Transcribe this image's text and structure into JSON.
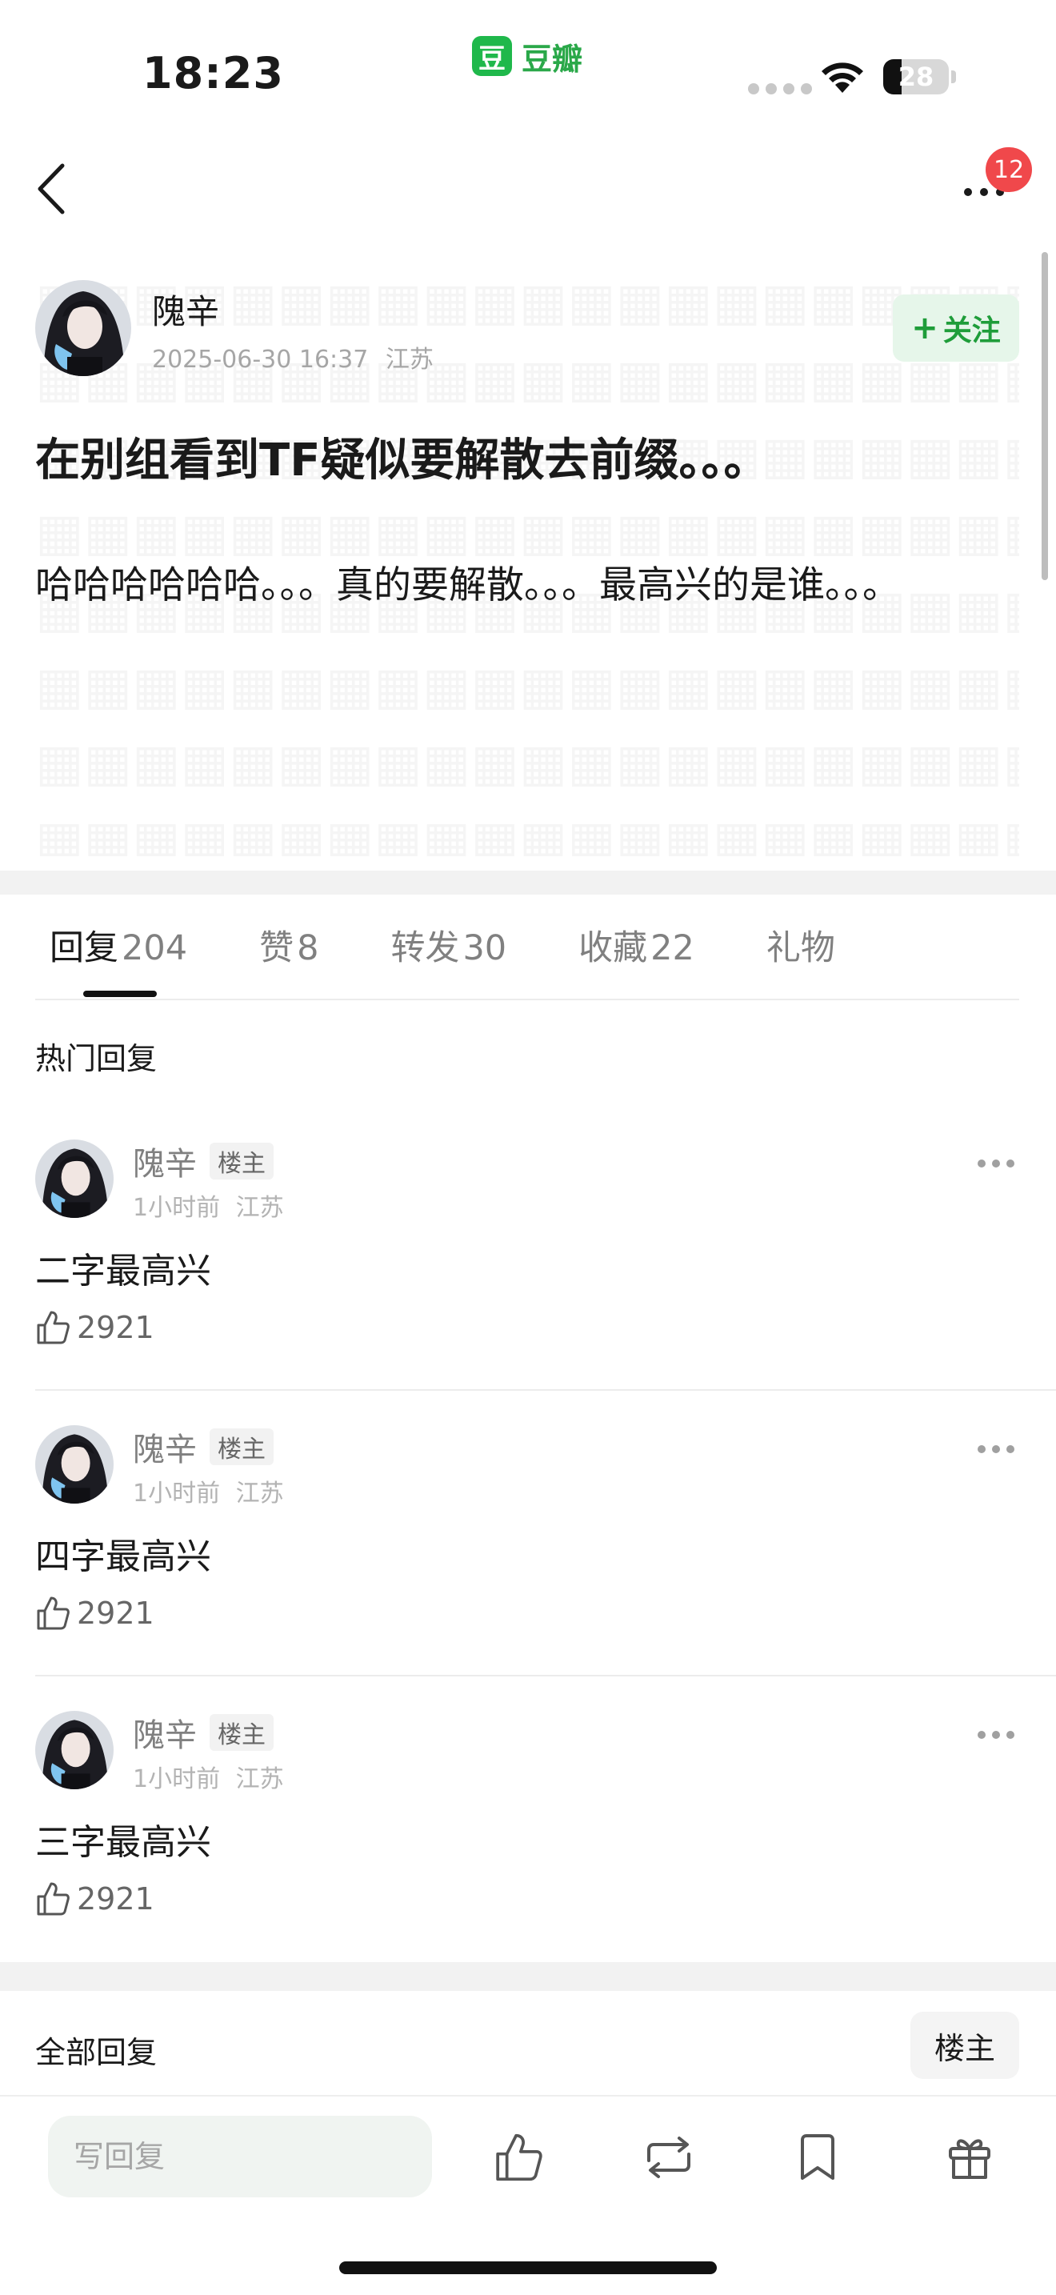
{
  "status_bar": {
    "time": "18:23",
    "app_badge_glyph": "豆",
    "app_name": "豆瓣",
    "battery_level": "28"
  },
  "nav": {
    "notification_count": "12"
  },
  "post": {
    "author_name": "隗辛",
    "timestamp": "2025-06-30 16:37",
    "location": "江苏",
    "follow_label": "关注",
    "title": "在别组看到TF疑似要解散去前缀。。。",
    "body": "哈哈哈哈哈哈。。。真的要解散。。。最高兴的是谁。。。"
  },
  "tabs": [
    {
      "label": "回复",
      "count": "204",
      "active": true
    },
    {
      "label": "赞",
      "count": "8",
      "active": false
    },
    {
      "label": "转发",
      "count": "30",
      "active": false
    },
    {
      "label": "收藏",
      "count": "22",
      "active": false
    },
    {
      "label": "礼物",
      "count": "",
      "active": false
    }
  ],
  "hot_replies": {
    "heading": "热门回复",
    "items": [
      {
        "name": "隗辛",
        "tag": "楼主",
        "time": "1小时前",
        "location": "江苏",
        "content": "二字最高兴",
        "likes": "2921"
      },
      {
        "name": "隗辛",
        "tag": "楼主",
        "time": "1小时前",
        "location": "江苏",
        "content": "四字最高兴",
        "likes": "2921"
      },
      {
        "name": "隗辛",
        "tag": "楼主",
        "time": "1小时前",
        "location": "江苏",
        "content": "三字最高兴",
        "likes": "2921"
      }
    ]
  },
  "all_replies": {
    "heading": "全部回复",
    "sort_label": "楼主"
  },
  "bottom_bar": {
    "reply_placeholder": "写回复",
    "icons": [
      "thumbs-up-icon",
      "repost-icon",
      "bookmark-icon",
      "gift-icon"
    ]
  },
  "colors": {
    "accent_green": "#1f9d3a",
    "badge_red": "#f0484b"
  }
}
